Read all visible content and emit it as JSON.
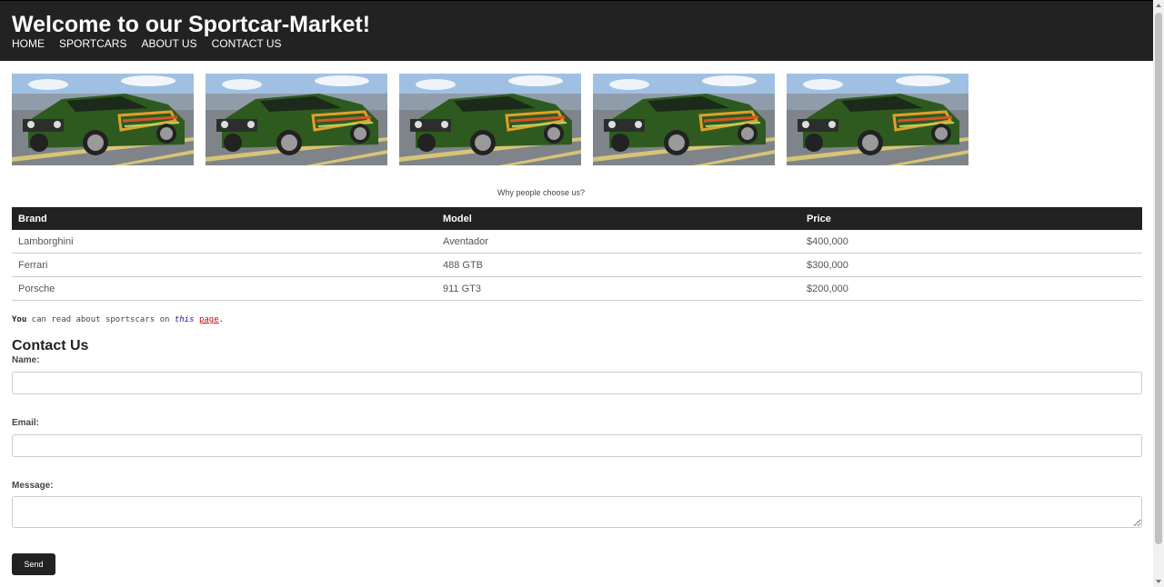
{
  "header": {
    "title": "Welcome to our Sportcar-Market!",
    "nav": [
      "HOME",
      "SPORTCARS",
      "ABOUT US",
      "CONTACT US"
    ]
  },
  "gallery": {
    "count": 5,
    "body_color": "#2f5a1f",
    "stripe_colors": [
      "#e0a02a",
      "#d4542a",
      "#b9d36a"
    ]
  },
  "caption": "Why people choose us?",
  "table": {
    "headers": [
      "Brand",
      "Model",
      "Price"
    ],
    "rows": [
      [
        "Lamborghini",
        "Aventador",
        "$400,000"
      ],
      [
        "Ferrari",
        "488 GTB",
        "$300,000"
      ],
      [
        "Porsche",
        "911 GT3",
        "$200,000"
      ]
    ]
  },
  "readline": {
    "bold": "You",
    "text": " can read about sportscars on ",
    "italic": "this",
    "link": "page",
    "end": "."
  },
  "contact": {
    "title": "Contact Us",
    "name_label": "Name:",
    "email_label": "Email:",
    "message_label": "Message:",
    "send_label": "Send"
  },
  "colors": {
    "header_bg": "#222222",
    "link_red": "#cc0000"
  }
}
